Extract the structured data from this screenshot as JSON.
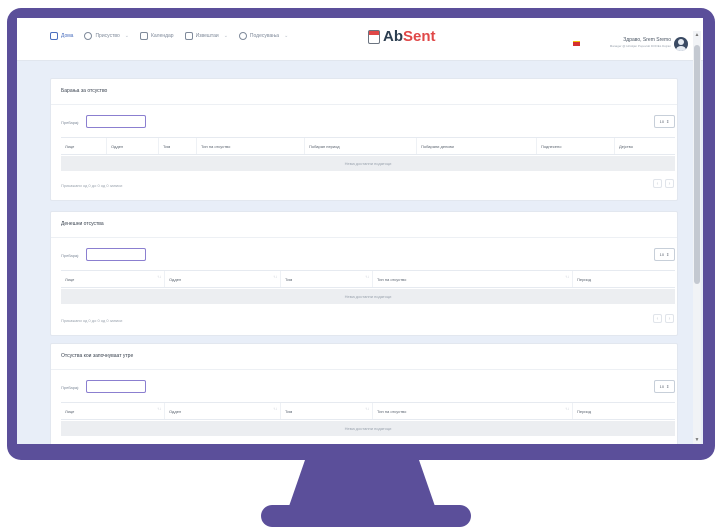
{
  "nav": {
    "items": [
      {
        "label": "Дома",
        "active": true,
        "has_caret": false
      },
      {
        "label": "Присуство",
        "active": false,
        "has_caret": true
      },
      {
        "label": "Календар",
        "active": false,
        "has_caret": false
      },
      {
        "label": "Извештаи",
        "active": false,
        "has_caret": true
      },
      {
        "label": "Подесувања",
        "active": false,
        "has_caret": true
      }
    ]
  },
  "logo": {
    "part1": "Ab",
    "part2": "Sent"
  },
  "user": {
    "name": "Здраво, Srem Sremo",
    "subtitle": "Manager @ Hristijan Popovski DOOEL Dojran"
  },
  "sections": [
    {
      "title": "Барања за отсуство",
      "search_label": "Пребарај:",
      "per_page": "10",
      "columns": [
        {
          "label": "Лице",
          "sortable": false
        },
        {
          "label": "Оддел",
          "sortable": false
        },
        {
          "label": "Тим",
          "sortable": false
        },
        {
          "label": "Тип на отсуство",
          "sortable": false
        },
        {
          "label": "Побаран период",
          "sortable": false
        },
        {
          "label": "Побарани денови",
          "sortable": false
        },
        {
          "label": "Поднесено",
          "sortable": false
        },
        {
          "label": "Дејство",
          "sortable": false
        }
      ],
      "empty_text": "Нема достапни податоци",
      "info": "Прикажани од 0 до 0 од 0 записи"
    },
    {
      "title": "Денешни отсуства",
      "search_label": "Пребарај:",
      "per_page": "10",
      "columns": [
        {
          "label": "Лице",
          "sortable": true
        },
        {
          "label": "Оддел",
          "sortable": true
        },
        {
          "label": "Тим",
          "sortable": true
        },
        {
          "label": "Тип на отсуство",
          "sortable": true
        },
        {
          "label": "Период",
          "sortable": false
        }
      ],
      "empty_text": "Нема достапни податоци",
      "info": "Прикажани од 0 до 0 од 0 записи"
    },
    {
      "title": "Отсуства кои започнуваат утре",
      "search_label": "Пребарај:",
      "per_page": "10",
      "columns": [
        {
          "label": "Лице",
          "sortable": true
        },
        {
          "label": "Оддел",
          "sortable": true
        },
        {
          "label": "Тим",
          "sortable": true
        },
        {
          "label": "Тип на отсуство",
          "sortable": true
        },
        {
          "label": "Период",
          "sortable": false
        }
      ],
      "empty_text": "Нема достапни податоци",
      "info": ""
    }
  ],
  "pager": {
    "prev": "‹",
    "next": "›"
  },
  "sort_glyph": "↑↓",
  "select_arrow": "⇕"
}
